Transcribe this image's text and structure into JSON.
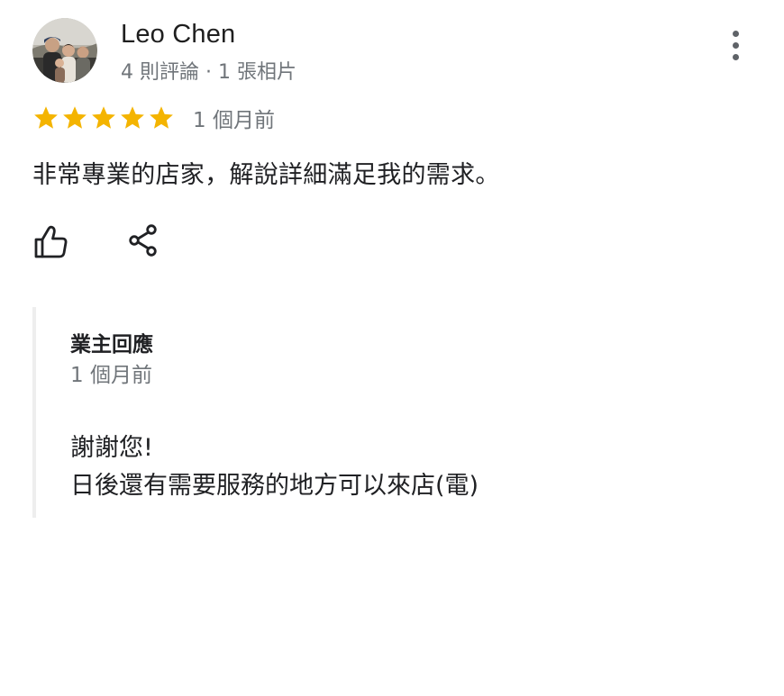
{
  "review": {
    "author": {
      "name": "Leo Chen",
      "meta": "4 則評論 · 1 張相片"
    },
    "rating": {
      "stars": 5,
      "max": 5,
      "color": "#F4B400"
    },
    "date": "1 個月前",
    "text": "非常專業的店家，解說詳細滿足我的需求。",
    "actions": {
      "like_icon": "thumb-up-icon",
      "share_icon": "share-icon",
      "more_icon": "more-vert-icon"
    }
  },
  "owner_response": {
    "title": "業主回應",
    "date": "1 個月前",
    "lines": [
      "謝謝您!",
      "日後還有需要服務的地方可以來店(電)"
    ]
  }
}
